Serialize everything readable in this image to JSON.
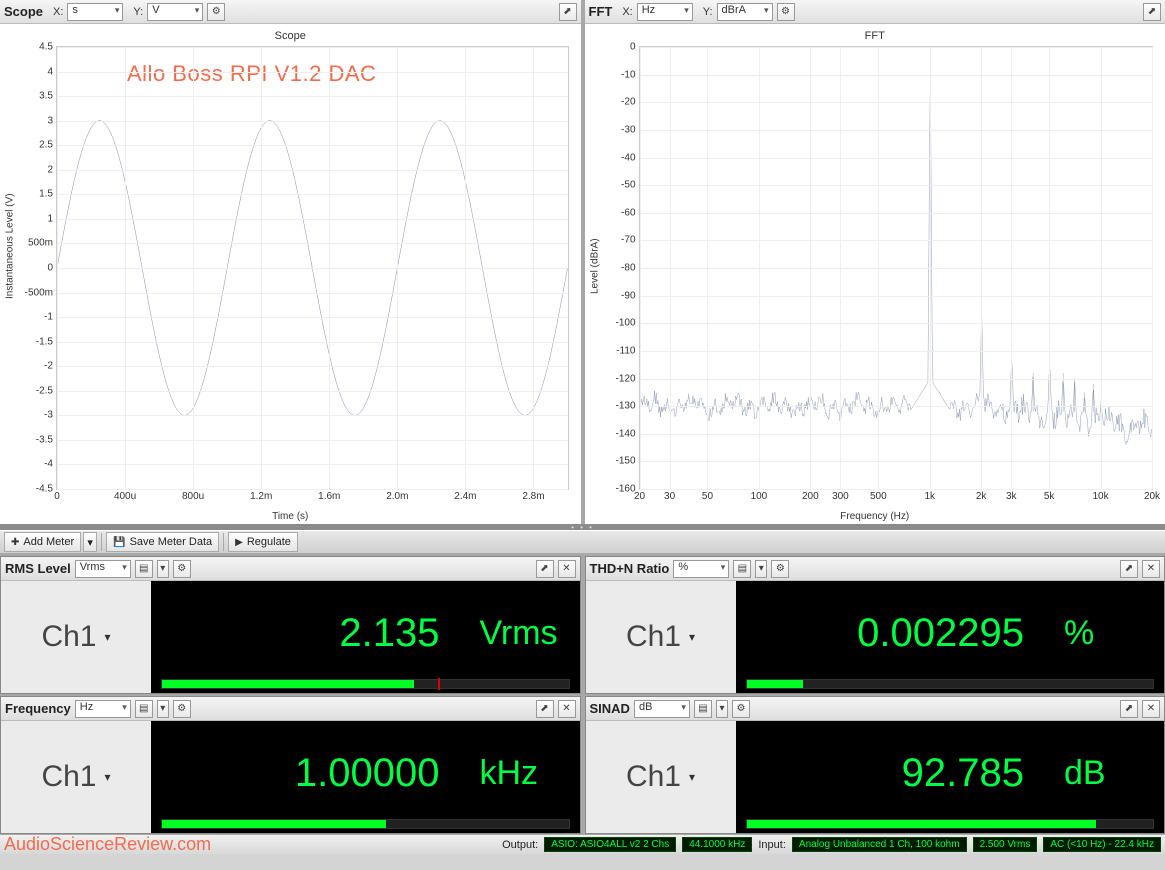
{
  "scope": {
    "title": "Scope",
    "x_label": "X:",
    "x_unit": "s",
    "y_label": "Y:",
    "y_unit": "V",
    "chart_title": "Scope",
    "y_axis_label": "Instantaneous Level (V)",
    "x_axis_label": "Time (s)",
    "annotation": "Allo Boss RPI V1.2 DAC"
  },
  "fft": {
    "title": "FFT",
    "x_label": "X:",
    "x_unit": "Hz",
    "y_label": "Y:",
    "y_unit": "dBrA",
    "chart_title": "FFT",
    "y_axis_label": "Level (dBrA)",
    "x_axis_label": "Frequency (Hz)"
  },
  "toolbar": {
    "add_meter": "Add Meter",
    "save_meter": "Save Meter Data",
    "regulate": "Regulate"
  },
  "meters": {
    "rms": {
      "title": "RMS Level",
      "unit_sel": "Vrms",
      "channel": "Ch1",
      "value": "2.135",
      "unit": "Vrms",
      "bar_pct": 62
    },
    "thdn": {
      "title": "THD+N Ratio",
      "unit_sel": "%",
      "channel": "Ch1",
      "value": "0.002295",
      "unit": "%",
      "bar_pct": 14
    },
    "freq": {
      "title": "Frequency",
      "unit_sel": "Hz",
      "channel": "Ch1",
      "value": "1.00000",
      "unit": "kHz",
      "bar_pct": 55
    },
    "sinad": {
      "title": "SINAD",
      "unit_sel": "dB",
      "channel": "Ch1",
      "value": "92.785",
      "unit": "dB",
      "bar_pct": 86
    }
  },
  "status": {
    "watermark": "AudioScienceReview.com",
    "output_lbl": "Output:",
    "output_driver": "ASIO: ASIO4ALL v2 2 Chs",
    "output_rate": "44.1000 kHz",
    "input_lbl": "Input:",
    "input_ch": "Analog Unbalanced 1 Ch, 100 kohm",
    "input_lvl": "2.500 Vrms",
    "input_bw": "AC (<10 Hz) - 22.4 kHz"
  },
  "chart_data": [
    {
      "type": "line",
      "title": "Scope",
      "xlabel": "Time (s)",
      "ylabel": "Instantaneous Level (V)",
      "xlim": [
        0,
        0.003
      ],
      "ylim": [
        -4.5,
        4.5
      ],
      "x": [
        0,
        0.0001,
        0.0002,
        0.0003,
        0.0004,
        0.0005,
        0.0006,
        0.0007,
        0.0008,
        0.0009,
        0.001,
        0.0011,
        0.0012,
        0.0013,
        0.0014,
        0.0015,
        0.0016,
        0.0017,
        0.0018,
        0.0019,
        0.002,
        0.0021,
        0.0022,
        0.0023,
        0.0024,
        0.0025,
        0.0026,
        0.0027,
        0.0028,
        0.0029,
        0.003
      ],
      "values": [
        0,
        1.76,
        2.85,
        2.85,
        1.76,
        0,
        -1.76,
        -2.85,
        -2.85,
        -1.76,
        0,
        1.76,
        2.85,
        2.85,
        1.76,
        0,
        -1.76,
        -2.85,
        -2.85,
        -1.76,
        0,
        1.76,
        2.85,
        2.85,
        1.76,
        0,
        -1.76,
        -2.85,
        -2.85,
        -1.76,
        0
      ],
      "y_ticks": [
        -4.5,
        -4.0,
        -3.5,
        -3.0,
        -2.5,
        -2.0,
        -1.5,
        -1.0,
        "-500m",
        0,
        "500m",
        1.0,
        1.5,
        2.0,
        2.5,
        3.0,
        3.5,
        4.0,
        4.5
      ],
      "x_ticks": [
        0,
        "400u",
        "800u",
        "1.2m",
        "1.6m",
        "2.0m",
        "2.4m",
        "2.8m"
      ],
      "annotation": "Allo Boss RPI V1.2 DAC",
      "frequency_hz": 1000,
      "amplitude_v": 3.0
    },
    {
      "type": "line",
      "title": "FFT",
      "xlabel": "Frequency (Hz)",
      "ylabel": "Level (dBrA)",
      "x_scale": "log",
      "xlim": [
        20,
        20000
      ],
      "ylim": [
        -160,
        0
      ],
      "x_ticks": [
        20,
        30,
        50,
        100,
        200,
        300,
        500,
        "1k",
        "2k",
        "3k",
        "5k",
        "10k",
        "20k"
      ],
      "y_ticks": [
        0,
        -10,
        -20,
        -30,
        -40,
        -50,
        -60,
        -70,
        -80,
        -90,
        -100,
        -110,
        -120,
        -130,
        -140,
        -150,
        -160
      ],
      "noise_floor_db": -130,
      "series": [
        {
          "name": "Ch1",
          "peaks": [
            {
              "freq": 1000,
              "level": 0
            },
            {
              "freq": 2000,
              "level": -95
            },
            {
              "freq": 3000,
              "level": -110
            },
            {
              "freq": 4000,
              "level": -118
            },
            {
              "freq": 5000,
              "level": -113
            },
            {
              "freq": 6000,
              "level": -118
            },
            {
              "freq": 7000,
              "level": -120
            },
            {
              "freq": 8000,
              "level": -125
            },
            {
              "freq": 9000,
              "level": -122
            },
            {
              "freq": 10000,
              "level": -128
            }
          ]
        }
      ]
    }
  ]
}
